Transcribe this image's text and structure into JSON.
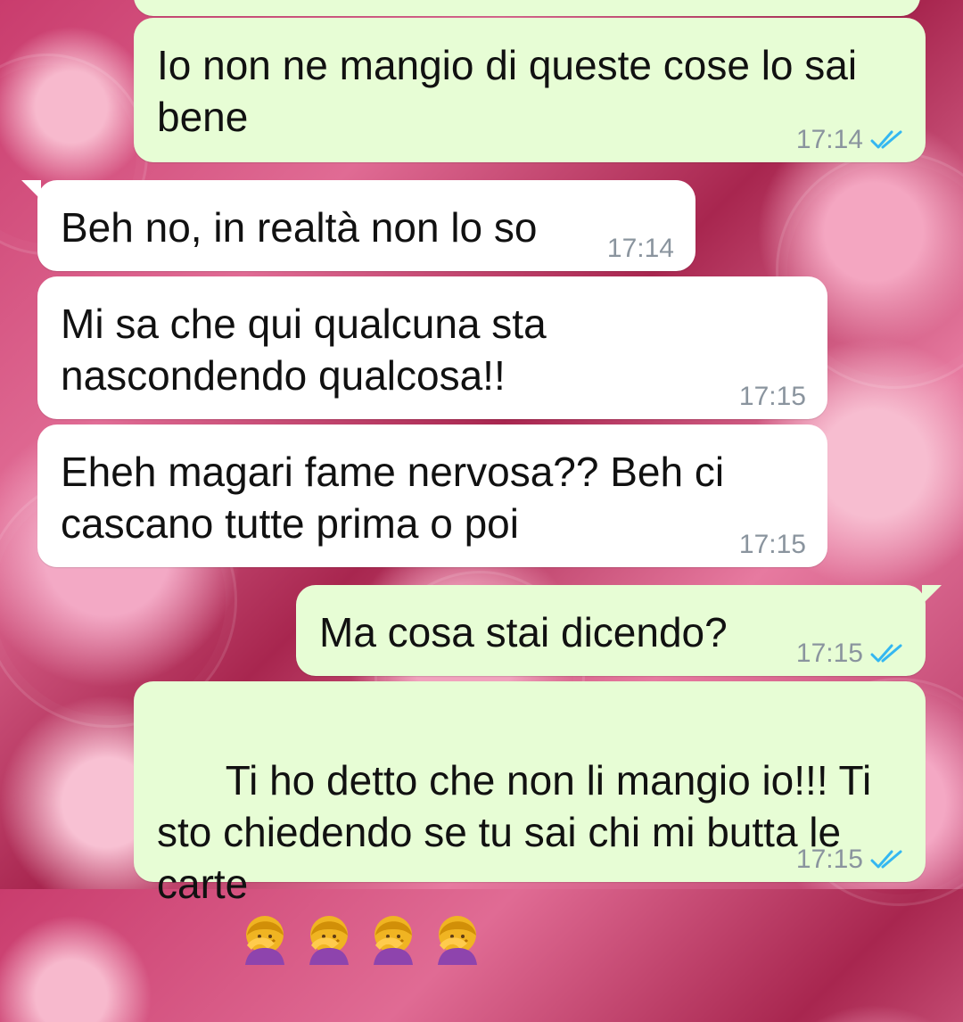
{
  "messages": [
    {
      "text": "",
      "time": "",
      "read_icon": ""
    },
    {
      "text": "Io non ne mangio di queste cose lo sai bene",
      "time": "17:14",
      "read_icon": "double-check-icon"
    },
    {
      "text": "Beh no, in realtà non lo so",
      "time": "17:14"
    },
    {
      "text": "Mi sa che qui qualcuna sta nascondendo qualcosa!!",
      "time": "17:15"
    },
    {
      "text": "Eheh magari fame nervosa?? Beh ci cascano tutte prima o poi",
      "time": "17:15"
    },
    {
      "text": "Ma cosa stai dicendo?",
      "time": "17:15",
      "read_icon": "double-check-icon"
    },
    {
      "text": "Ti ho detto che non li mangio io!!! Ti sto chiedendo se tu sai chi mi butta le carte",
      "emoji": [
        "facepalm-woman-icon",
        "facepalm-woman-icon",
        "facepalm-woman-icon",
        "facepalm-woman-icon"
      ],
      "time": "17:15",
      "read_icon": "double-check-icon"
    }
  ],
  "colors": {
    "outgoing_bubble": "#e7fdd5",
    "incoming_bubble": "#ffffff",
    "meta_text": "#8a949e",
    "read_tick": "#34b7f1"
  }
}
